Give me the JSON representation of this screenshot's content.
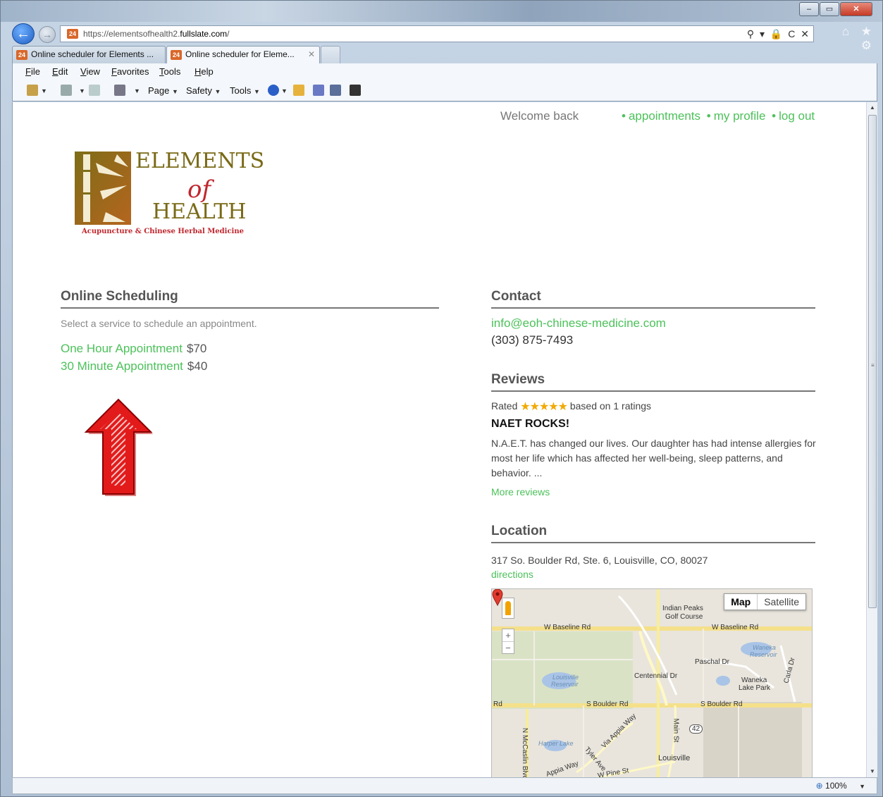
{
  "browser": {
    "url_prefix": "https://elementsofhealth2.",
    "url_domain": "fullslate.com",
    "url_suffix": "/",
    "address_tools": "⚲ ▾ 🔒 C ✕",
    "right_icons": "⌂ ★ ⚙",
    "window_controls": {
      "minimize": "–",
      "maximize": "▭",
      "close": "✕"
    },
    "favicon_label": "24",
    "tabs": [
      {
        "label": "Online scheduler for Elements ...",
        "active": false
      },
      {
        "label": "Online scheduler for Eleme...",
        "active": true,
        "close": "✕"
      }
    ],
    "menu": [
      {
        "key": "F",
        "rest": "ile"
      },
      {
        "key": "E",
        "rest": "dit"
      },
      {
        "key": "V",
        "rest": "iew"
      },
      {
        "key": "F",
        "rest": "avorites",
        "pre": ""
      },
      {
        "key": "T",
        "rest": "ools"
      },
      {
        "key": "H",
        "rest": "elp"
      }
    ],
    "commands": {
      "page": "Page",
      "safety": "Safety",
      "tools": "Tools"
    },
    "zoom": "100%",
    "colors": {
      "accent_green": "#4cc15a",
      "heading_gray": "#555555",
      "logo_olive": "#7a6a17",
      "logo_red": "#c0262d"
    }
  },
  "page": {
    "header": {
      "welcome": "Welcome back",
      "links": [
        "appointments",
        "my profile",
        "log out"
      ],
      "separator": "•"
    },
    "logo": {
      "line1": "ELEMENTS",
      "line2": "of",
      "line3": "HEALTH",
      "tagline": "Acupuncture & Chinese Herbal Medicine"
    },
    "scheduling": {
      "title": "Online Scheduling",
      "subtitle": "Select a service to schedule an appointment.",
      "services": [
        {
          "name": "One Hour Appointment",
          "price": "$70"
        },
        {
          "name": "30 Minute Appointment",
          "price": "$40"
        }
      ]
    },
    "contact": {
      "title": "Contact",
      "email": "info@eoh-chinese-medicine.com",
      "phone": "(303) 875-7493"
    },
    "reviews": {
      "title": "Reviews",
      "rated_prefix": "Rated",
      "stars": "★★★★★",
      "rated_suffix": "based on 1 ratings",
      "rating": 5,
      "rating_max": 5,
      "review_title": "NAET ROCKS!",
      "review_body": "N.A.E.T. has changed our lives. Our daughter has had intense allergies for most her life which has affected her well-being, sleep patterns, and behavior. ...",
      "more": "More reviews"
    },
    "location": {
      "title": "Location",
      "address": "317 So. Boulder Rd, Ste. 6, Louisville, CO, 80027",
      "directions": "directions",
      "map": {
        "type_map": "Map",
        "type_satellite": "Satellite",
        "zoom_in": "+",
        "zoom_out": "−",
        "labels": {
          "golf1": "Indian Peaks",
          "golf2": "Golf Course",
          "wbase1": "W Baseline Rd",
          "wbase2": "W Baseline Rd",
          "waneka_res1": "Waneka",
          "waneka_res2": "Reservoir",
          "paschal": "Paschal Dr",
          "centennial": "Centennial Dr",
          "lou_res1": "Louisville",
          "lou_res2": "Reservoir",
          "waneka_park1": "Waneka",
          "waneka_park2": "Lake Park",
          "carla": "Carla Dr",
          "sb1": "S Boulder Rd",
          "sb2": "S Boulder Rd",
          "rd": "Rd",
          "main": "Main St",
          "hwy": "42",
          "mccaslin": "N McCaslin Blvd",
          "harper": "Harper Lake",
          "appia1": "Via Appia Way",
          "tyler": "Tyler Ave",
          "appia2": "Appia Way",
          "pine": "W Pine St",
          "louisville": "Louisville"
        }
      }
    }
  }
}
